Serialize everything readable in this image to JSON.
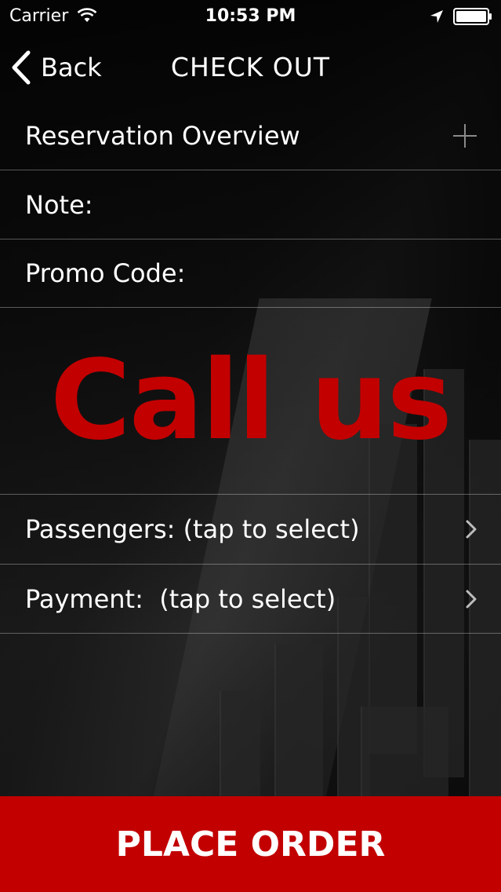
{
  "status_bar": {
    "carrier": "Carrier",
    "time": "10:53 PM"
  },
  "nav": {
    "back_label": "Back",
    "title": "CHECK OUT"
  },
  "rows": {
    "reservation": "Reservation Overview",
    "note": "Note:",
    "promo": "Promo Code:",
    "passengers": "Passengers: (tap to select)",
    "payment": "Payment:  (tap to select)"
  },
  "banner": {
    "call_us": "Call us"
  },
  "footer": {
    "place_order": "PLACE ORDER"
  },
  "colors": {
    "accent_red": "#c20000",
    "background": "#0b0b0b",
    "text": "#ffffff"
  },
  "icons": {
    "wifi": "wifi-icon",
    "location": "location-arrow-icon",
    "battery": "battery-icon",
    "back": "chevron-left-icon",
    "expand": "plus-icon",
    "disclosure": "chevron-right-icon"
  }
}
